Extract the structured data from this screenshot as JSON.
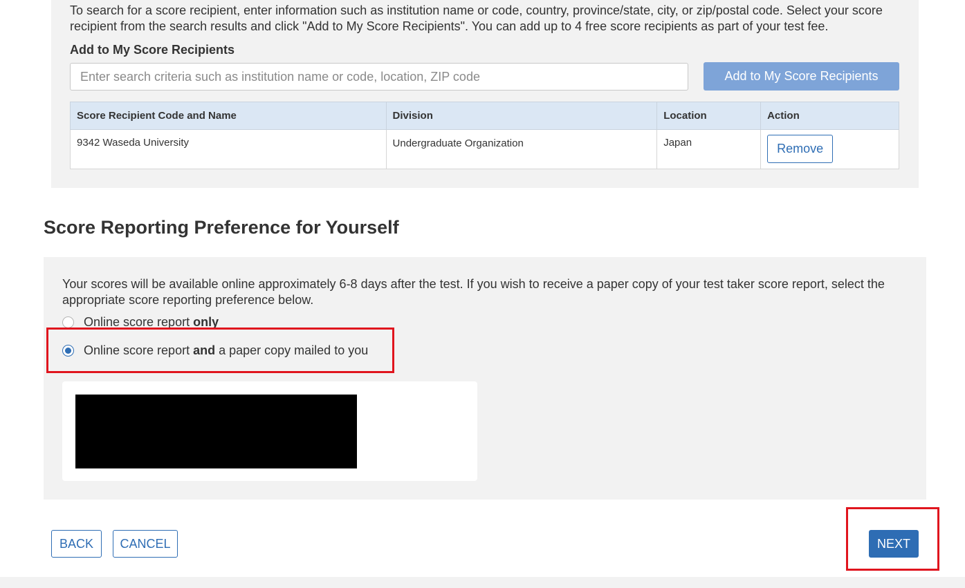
{
  "search_section": {
    "intro_text": "To search for a score recipient, enter information such as institution name or code, country, province/state, city, or zip/postal code. Select your score recipient from the search results and click \"Add to My Score Recipients\". You can add up to 4 free score recipients as part of your test fee.",
    "add_heading": "Add to My Score Recipients",
    "search_placeholder": "Enter search criteria such as institution name or code, location, ZIP code",
    "search_value": "",
    "add_button_label": "Add to My Score Recipients"
  },
  "recipients_table": {
    "headers": [
      "Score Recipient Code and Name",
      "Division",
      "Location",
      "Action"
    ],
    "rows": [
      {
        "code_and_name": "9342 Waseda University",
        "division": "Undergraduate Organization",
        "location": "Japan",
        "action_label": "Remove"
      }
    ]
  },
  "preference": {
    "heading": "Score Reporting Preference for Yourself",
    "description": "Your scores will be available online approximately 6-8 days after the test. If you wish to receive a paper copy of your test taker score report, select the appropriate score reporting preference below.",
    "options": [
      {
        "pre": "Online score report",
        "bold": "only",
        "post": "",
        "selected": false
      },
      {
        "pre": "Online score report",
        "bold": "and",
        "post": "a paper copy mailed to you",
        "selected": true
      }
    ]
  },
  "footer_buttons": {
    "back": "BACK",
    "cancel": "CANCEL",
    "next": "NEXT"
  },
  "colors": {
    "primary": "#2e6db4",
    "primary_light": "#7ea4d8",
    "highlight": "#e0151e",
    "panel_bg": "#f2f2f2",
    "table_header_bg": "#dbe7f4"
  }
}
